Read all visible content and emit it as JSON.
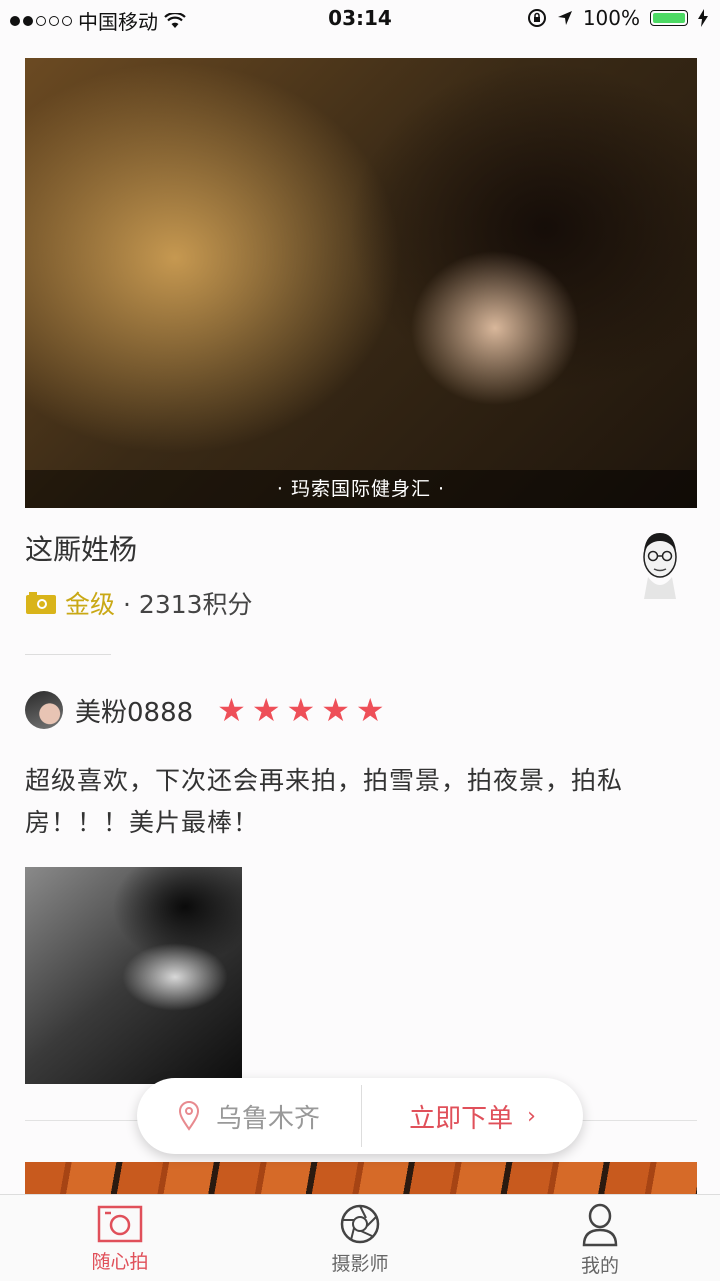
{
  "status_bar": {
    "carrier": "中国移动",
    "time": "03:14",
    "battery": "100%",
    "signal_bars_filled": 2,
    "signal_bars_total": 5
  },
  "hero": {
    "caption": "· 玛索国际健身汇 ·"
  },
  "photographer": {
    "name": "这厮姓杨",
    "level": "金级",
    "points": "· 2313积分"
  },
  "review": {
    "reviewer": "美粉0888",
    "rating": 5,
    "text": "超级喜欢，下次还会再来拍，拍雪景，拍夜景，拍私房！！！美片最棒！"
  },
  "order_pill": {
    "city": "乌鲁木齐",
    "order_label": "立即下单",
    "chevron": "›"
  },
  "tabs": [
    {
      "label": "随心拍",
      "icon": "camera-icon",
      "active": true
    },
    {
      "label": "摄影师",
      "icon": "aperture-icon",
      "active": false
    },
    {
      "label": "我的",
      "icon": "user-icon",
      "active": false
    }
  ],
  "colors": {
    "accent": "#e0505a",
    "star": "#ee4f58",
    "gold": "#c9a815",
    "battery": "#4cd964"
  }
}
